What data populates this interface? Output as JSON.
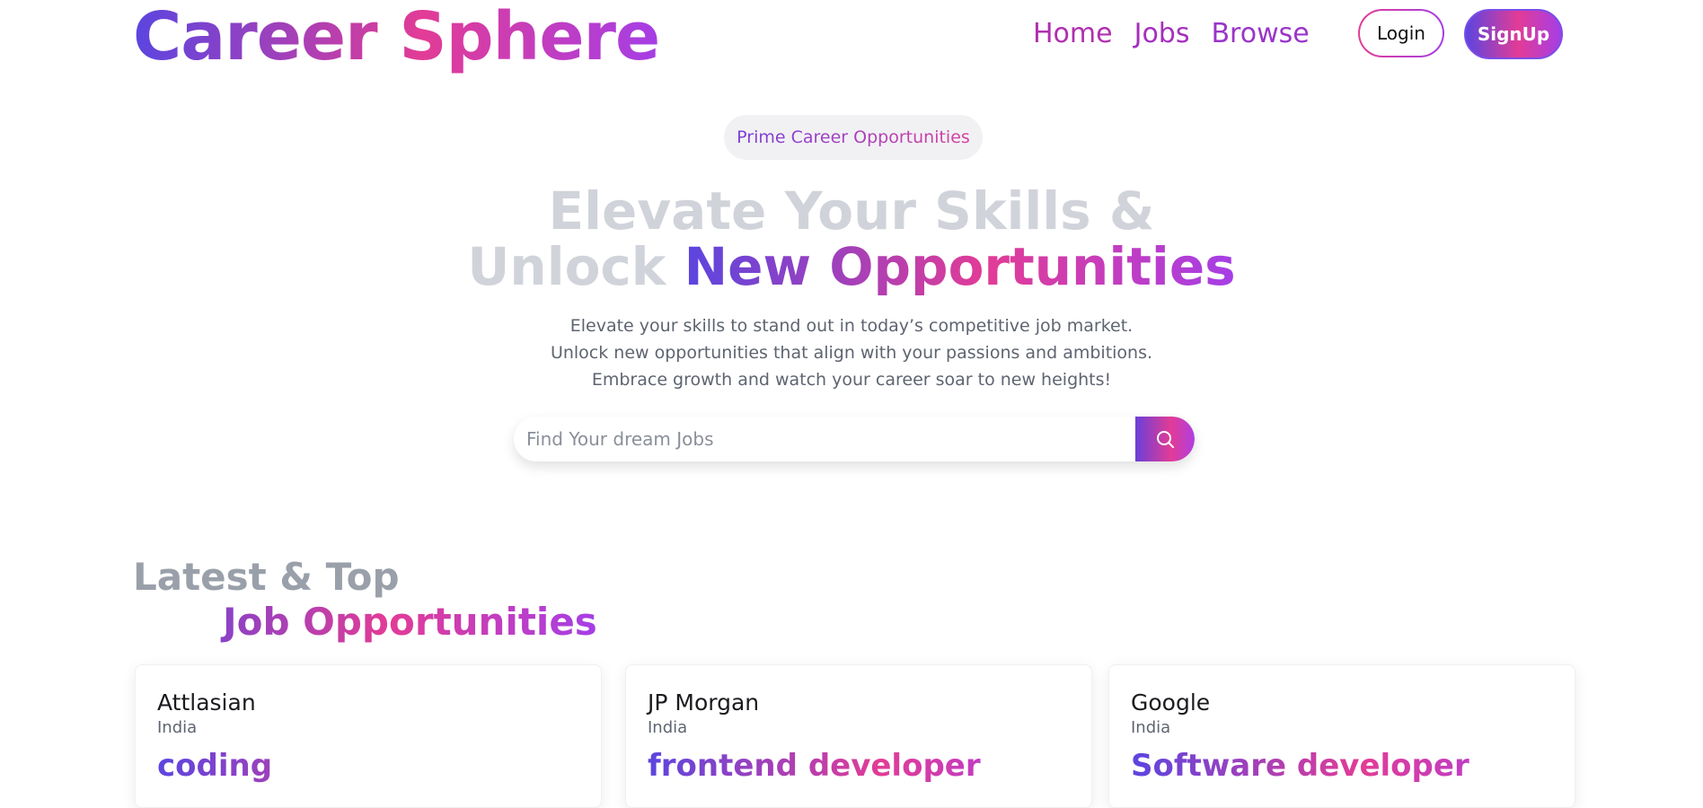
{
  "brand": {
    "name": "Career Sphere"
  },
  "nav": {
    "items": [
      {
        "label": "Home"
      },
      {
        "label": "Jobs"
      },
      {
        "label": "Browse"
      }
    ],
    "login_label": "Login",
    "signup_label": "SignUp"
  },
  "hero": {
    "badge": "Prime Career Opportunities",
    "title_line1": "Elevate Your Skills &",
    "title_line2_plain": "Unlock ",
    "title_line2_highlight": "New Opportunities",
    "subtitle_lines": [
      "Elevate your skills to stand out in today’s competitive job market.",
      "Unlock new opportunities that align with your passions and ambitions.",
      "Embrace growth and watch your career soar to new heights!"
    ],
    "search": {
      "placeholder": "Find Your dream Jobs",
      "icon": "search-icon"
    }
  },
  "latest": {
    "title_line1": "Latest & Top",
    "title_line2": "Job Opportunities",
    "jobs": [
      {
        "company": "Attlasian",
        "location": "India",
        "role": "coding"
      },
      {
        "company": "JP Morgan",
        "location": "India",
        "role": "frontend developer"
      },
      {
        "company": "Google",
        "location": "India",
        "role": "Software developer"
      }
    ]
  },
  "colors": {
    "gradient_start": "#5b45e0",
    "gradient_mid": "#e23c96",
    "gradient_end": "#a53ee6",
    "muted_heading": "#d1d3da",
    "body_text": "#5e6470"
  }
}
